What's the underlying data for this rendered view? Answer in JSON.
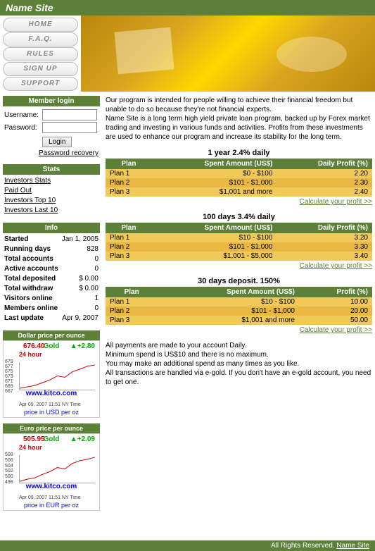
{
  "site_name": "Name Site",
  "nav": [
    "HOME",
    "F.A.Q.",
    "RULES",
    "SIGN UP",
    "SUPPORT"
  ],
  "login": {
    "title": "Member login",
    "user_label": "Username:",
    "pass_label": "Password:",
    "button": "Login",
    "recovery": "Password recovery"
  },
  "stats": {
    "title": "Stats",
    "links": [
      "Investors Stats",
      "Paid Out",
      "Investors Top 10",
      "Investors Last 10"
    ]
  },
  "info": {
    "title": "Info",
    "rows": [
      {
        "k": "Started",
        "v": "Jan 1, 2005"
      },
      {
        "k": "Running days",
        "v": "828"
      },
      {
        "k": "Total accounts",
        "v": "0"
      },
      {
        "k": "Active accounts",
        "v": "0"
      },
      {
        "k": "Total deposited",
        "v": "$ 0.00"
      },
      {
        "k": "Total withdraw",
        "v": "$ 0.00"
      },
      {
        "k": "Visitors online",
        "v": "1"
      },
      {
        "k": "Members online",
        "v": "0"
      },
      {
        "k": "Last update",
        "v": "Apr 9, 2007"
      }
    ]
  },
  "chart1": {
    "title": "Dollar price per ounce",
    "label": "24 hour",
    "gold": "Gold",
    "price": "676.40",
    "delta": "▲+2.80",
    "kitco": "www.kitco.com",
    "date": "Apr 09, 2007 11:51 NY Time",
    "caption": "price in USD per oz",
    "yticks": [
      "679",
      "677",
      "675",
      "673",
      "671",
      "669",
      "667"
    ]
  },
  "chart2": {
    "title": "Euro price per ounce",
    "label": "24 hour",
    "gold": "Gold",
    "price": "505.95",
    "delta": "▲+2.09",
    "kitco": "www.kitco.com",
    "date": "Apr 09, 2007 11:51 NY Time",
    "caption": "price in EUR per oz",
    "yticks": [
      "508",
      "506",
      "504",
      "502",
      "500",
      "498"
    ]
  },
  "intro": {
    "p1": "Our program is intended for people willing to achieve their financial freedom but unable to do so because they're not financial experts.",
    "p2": "Name Site is a long term high yield private loan program, backed up by Forex market trading and investing in various funds and activities. Profits from these investments are used to enhance our program and increase its stability for the long term."
  },
  "plans": [
    {
      "title": "1 year 2.4% daily",
      "head": [
        "Plan",
        "Spent Amount (US$)",
        "Daily Profit (%)"
      ],
      "rows": [
        [
          "Plan 1",
          "$0 - $100",
          "2.20"
        ],
        [
          "Plan 2",
          "$101 - $1,000",
          "2.30"
        ],
        [
          "Plan 3",
          "$1,001 and more",
          "2.40"
        ]
      ]
    },
    {
      "title": "100 days 3.4% daily",
      "head": [
        "Plan",
        "Spent Amount (US$)",
        "Daily Profit (%)"
      ],
      "rows": [
        [
          "Plan 1",
          "$10 - $100",
          "3.20"
        ],
        [
          "Plan 2",
          "$101 - $1,000",
          "3.30"
        ],
        [
          "Plan 3",
          "$1,001 - $5,000",
          "3.40"
        ]
      ]
    },
    {
      "title": "30 days deposit. 150%",
      "head": [
        "Plan",
        "Spent Amount (US$)",
        "Profit (%)"
      ],
      "rows": [
        [
          "Plan 1",
          "$10 - $100",
          "10.00"
        ],
        [
          "Plan 2",
          "$101 - $1,000",
          "20.00"
        ],
        [
          "Plan 3",
          "$1,001 and more",
          "50.00"
        ]
      ]
    }
  ],
  "calc_label": "Calculate your profit >>",
  "payinfo": {
    "l1": "All payments are made to your account Daily.",
    "l2": "Minimum spend is US$10 and there is no maximum.",
    "l3": "You may make an additional spend as many times as you like.",
    "l4": "All transactions are handled via e-gold. If you don't have an e-gold account, you need to get one."
  },
  "footer": {
    "text": "All Rights Reserved. ",
    "link": "Name Site"
  }
}
